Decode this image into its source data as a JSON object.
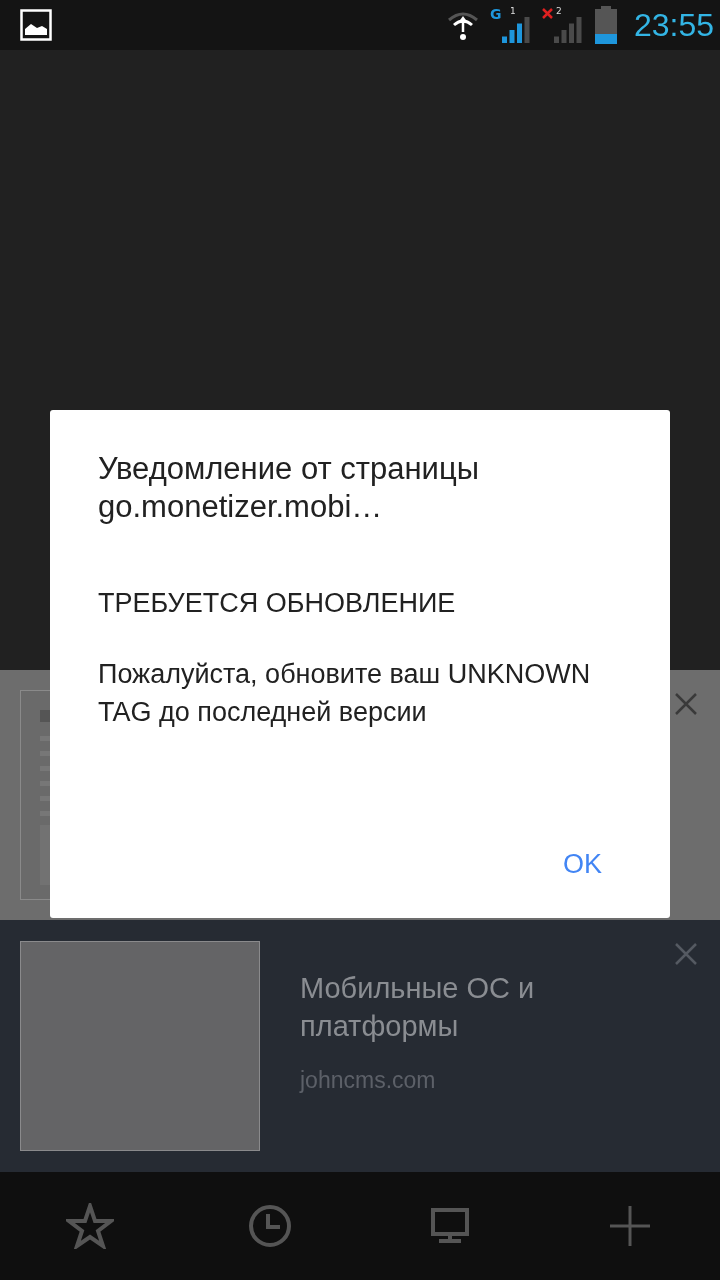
{
  "status_bar": {
    "sim1": {
      "network": "G",
      "slot": "1"
    },
    "sim2": {
      "slot": "2"
    },
    "time": "23:55"
  },
  "recent_cards": [
    {
      "kind": "blank"
    },
    {
      "kind": "titled",
      "title": "Мобильные ОС и платформы",
      "url": "johncms.com"
    }
  ],
  "dialog": {
    "title": "Уведомление от страницы go.monetizer.mobi…",
    "heading": "ТРЕБУЕТСЯ ОБНОВЛЕНИЕ",
    "message": "Пожалуйста, обновите ваш UNKNOWN TAG до последней версии",
    "button": "OK"
  }
}
